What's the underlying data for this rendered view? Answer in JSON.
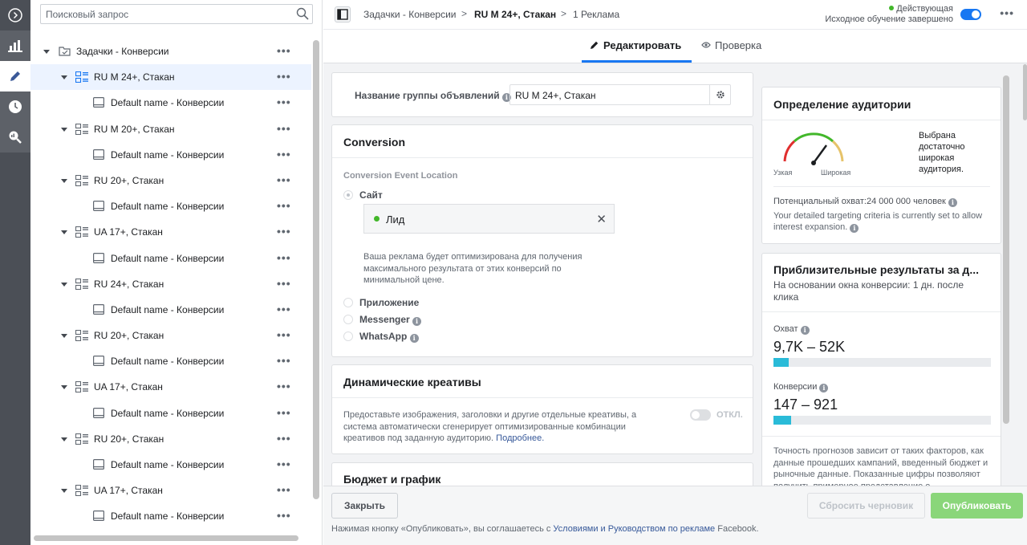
{
  "search": {
    "placeholder": "Поисковый запрос"
  },
  "tree": {
    "root": "Задачки - Конверсии",
    "rows": [
      {
        "type": "adset",
        "label": "RU M 24+, Стакан",
        "active": true
      },
      {
        "type": "ad",
        "label": "Default name - Конверсии"
      },
      {
        "type": "adset",
        "label": "RU M 20+, Стакан"
      },
      {
        "type": "ad",
        "label": "Default name - Конверсии"
      },
      {
        "type": "adset",
        "label": "RU 20+, Стакан"
      },
      {
        "type": "ad",
        "label": "Default name - Конверсии"
      },
      {
        "type": "adset",
        "label": "UA 17+, Стакан"
      },
      {
        "type": "ad",
        "label": "Default name - Конверсии"
      },
      {
        "type": "adset",
        "label": "RU 24+, Стакан"
      },
      {
        "type": "ad",
        "label": "Default name - Конверсии"
      },
      {
        "type": "adset",
        "label": "RU 20+, Стакан"
      },
      {
        "type": "ad",
        "label": "Default name - Конверсии"
      },
      {
        "type": "adset",
        "label": "UA 17+, Стакан"
      },
      {
        "type": "ad",
        "label": "Default name - Конверсии"
      },
      {
        "type": "adset",
        "label": "RU 20+, Стакан"
      },
      {
        "type": "ad",
        "label": "Default name - Конверсии"
      },
      {
        "type": "adset",
        "label": "UA 17+, Стакан"
      },
      {
        "type": "ad",
        "label": "Default name - Конверсии"
      }
    ],
    "more": "•••"
  },
  "header": {
    "breadcrumb1": "Задачки - Конверсии",
    "breadcrumb2": "RU M 24+, Стакан",
    "breadcrumb3": "1 Реклама",
    "sep": ">",
    "status_line1": "Действующая",
    "status_line2": "Исходное обучение завершено",
    "more": "•••"
  },
  "tabs": {
    "edit": "Редактировать",
    "review": "Проверка"
  },
  "adset_name": {
    "label": "Название группы объявлений",
    "value": "RU M 24+, Стакан"
  },
  "conversion": {
    "title": "Conversion",
    "location_label": "Conversion Event Location",
    "site": "Сайт",
    "event": "Лид",
    "note": "Ваша реклама будет оптимизирована для получения максимального результата от этих конверсий по минимальной цене.",
    "app": "Приложение",
    "messenger": "Messenger",
    "whatsapp": "WhatsApp"
  },
  "dynamic": {
    "title": "Динамические креативы",
    "text": "Предоставьте изображения, заголовки и другие отдельные креативы, а система автоматически сгенерирует оптимизированные комбинации креативов под заданную аудиторию.",
    "link": "Подробнее.",
    "toggle": "ОТКЛ."
  },
  "budget": {
    "title": "Бюджет и график"
  },
  "audience": {
    "title": "Определение аудитории",
    "verdict": "Выбрана достаточно широкая аудитория.",
    "narrow": "Узкая",
    "broad": "Широкая",
    "potential": "Потенциальный охват:24 000 000 человек",
    "detail": "Your detailed targeting criteria is currently set to allow interest expansion."
  },
  "estimates": {
    "title": "Приблизительные результаты за д...",
    "subtitle": "На основании окна конверсии: 1 дн. после клика",
    "reach_label": "Охват",
    "reach_value": "9,7K – 52K",
    "reach_fill": 0.07,
    "conv_label": "Конверсии",
    "conv_value": "147 – 921",
    "conv_fill": 0.08,
    "footnote": "Точность прогнозов зависит от таких факторов, как данные прошедших кампаний, введенный бюджет и рыночные данные. Показанные цифры позволяют получить примерное представление о"
  },
  "footer": {
    "close": "Закрыть",
    "discard": "Сбросить черновик",
    "publish": "Опубликовать",
    "terms_pre": "Нажимая кнопку «Опубликовать», вы соглашаетесь с",
    "terms_link": "Условиями и Руководством по рекламе",
    "terms_post": "Facebook."
  },
  "colors": {
    "accent": "#1877f2",
    "publish": "#42b72a",
    "bar": "#2abbd8"
  }
}
